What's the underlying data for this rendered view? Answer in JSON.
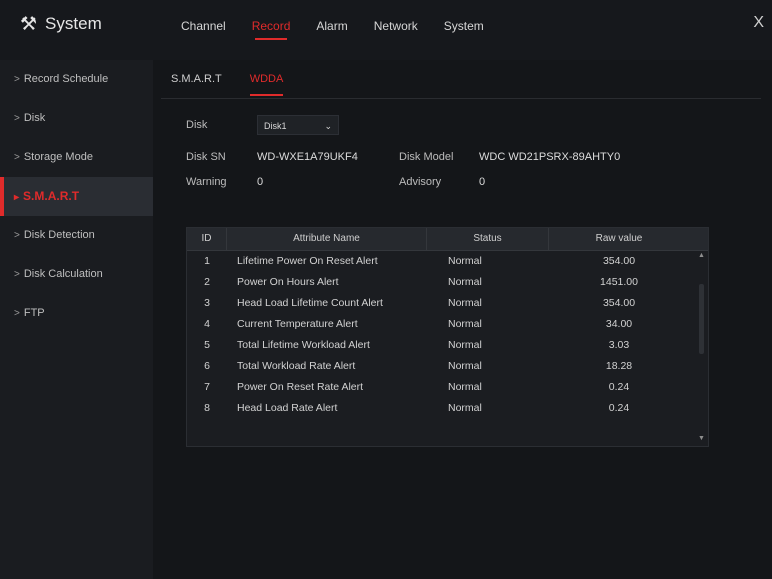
{
  "app": {
    "title": "System",
    "logo_icon": "tools-icon"
  },
  "nav": {
    "tabs": [
      {
        "label": "Channel"
      },
      {
        "label": "Record"
      },
      {
        "label": "Alarm"
      },
      {
        "label": "Network"
      },
      {
        "label": "System"
      }
    ],
    "active_index": 1,
    "close_label": "X"
  },
  "sidebar": {
    "items": [
      {
        "label": "Record Schedule"
      },
      {
        "label": "Disk"
      },
      {
        "label": "Storage Mode"
      },
      {
        "label": "S.M.A.R.T"
      },
      {
        "label": "Disk Detection"
      },
      {
        "label": "Disk Calculation"
      },
      {
        "label": "FTP"
      }
    ],
    "active_index": 3
  },
  "subtabs": {
    "items": [
      {
        "label": "S.M.A.R.T"
      },
      {
        "label": "WDDA"
      }
    ],
    "active_index": 1
  },
  "form": {
    "disk_label": "Disk",
    "disk_value": "Disk1",
    "disk_sn_label": "Disk SN",
    "disk_sn_value": "WD-WXE1A79UKF4",
    "disk_model_label": "Disk Model",
    "disk_model_value": "WDC WD21PSRX-89AHTY0",
    "warning_label": "Warning",
    "warning_value": "0",
    "advisory_label": "Advisory",
    "advisory_value": "0"
  },
  "table": {
    "headers": {
      "id": "ID",
      "name": "Attribute Name",
      "status": "Status",
      "raw": "Raw value"
    },
    "rows": [
      {
        "id": "1",
        "name": "Lifetime Power On Reset Alert",
        "status": "Normal",
        "raw": "354.00"
      },
      {
        "id": "2",
        "name": "Power On Hours Alert",
        "status": "Normal",
        "raw": "1451.00"
      },
      {
        "id": "3",
        "name": "Head Load Lifetime Count Alert",
        "status": "Normal",
        "raw": "354.00"
      },
      {
        "id": "4",
        "name": "Current Temperature Alert",
        "status": "Normal",
        "raw": "34.00"
      },
      {
        "id": "5",
        "name": "Total Lifetime Workload Alert",
        "status": "Normal",
        "raw": "3.03"
      },
      {
        "id": "6",
        "name": "Total Workload Rate Alert",
        "status": "Normal",
        "raw": "18.28"
      },
      {
        "id": "7",
        "name": "Power On Reset Rate Alert",
        "status": "Normal",
        "raw": "0.24"
      },
      {
        "id": "8",
        "name": "Head Load Rate Alert",
        "status": "Normal",
        "raw": "0.24"
      }
    ]
  },
  "colors": {
    "accent": "#e02b2b",
    "background": "#14161a",
    "panel": "#1b1d21"
  }
}
